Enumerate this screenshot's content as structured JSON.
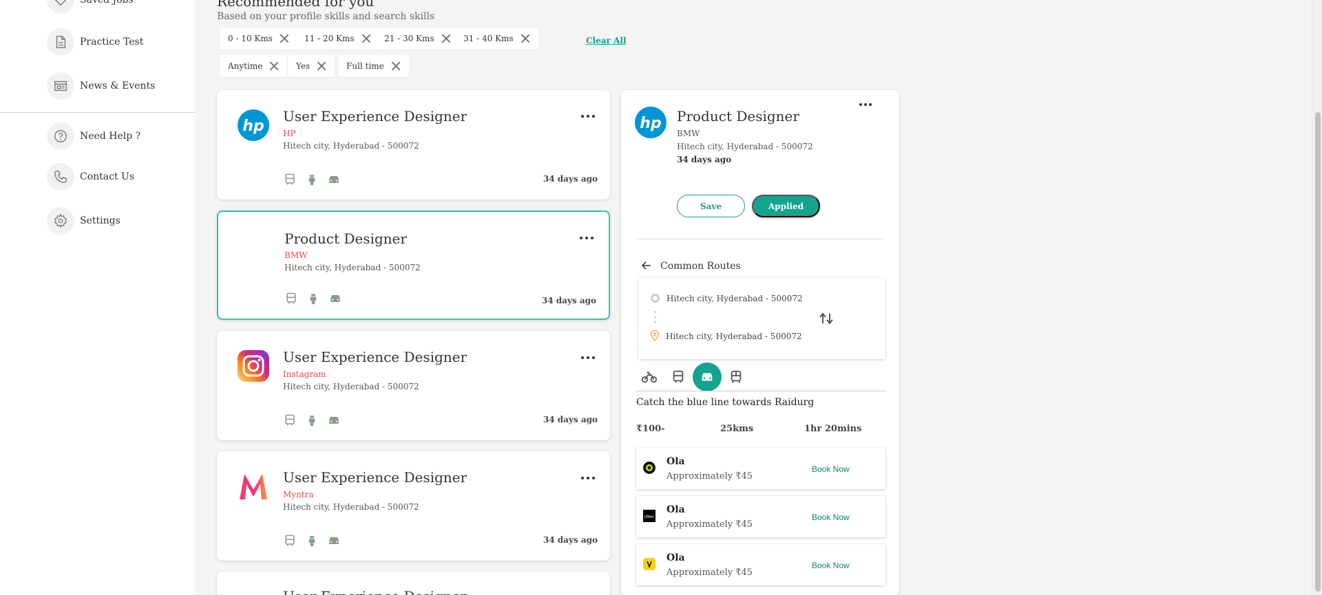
{
  "sidebar": {
    "items": [
      {
        "label": "Saved Jobs",
        "icon": "heart-icon"
      },
      {
        "label": "Practice Test",
        "icon": "document-icon"
      },
      {
        "label": "News & Events",
        "icon": "news-icon"
      },
      {
        "label": "Need Help ?",
        "icon": "help-icon"
      },
      {
        "label": "Contact Us",
        "icon": "phone-icon"
      },
      {
        "label": "Settings",
        "icon": "gear-icon"
      }
    ]
  },
  "main": {
    "title": "Recommended for you",
    "subtitle": "Based on your profile skills and search skills",
    "filters": [
      "0 - 10 Kms",
      "11 - 20 Kms",
      "21 - 30 Kms",
      "31 - 40 Kms",
      "Anytime",
      "Yes",
      "Full time"
    ],
    "clear_all": "Clear All"
  },
  "jobs": [
    {
      "title": "User Experience Designer",
      "company": "HP",
      "location": "Hitech city, Hyderabad - 500072",
      "ago": "34 days ago",
      "logo": "hp-logo"
    },
    {
      "title": "Product Designer",
      "company": "BMW",
      "location": "Hitech city, Hyderabad - 500072",
      "ago": "34 days ago",
      "logo": "none",
      "selected": true
    },
    {
      "title": "User Experience Designer",
      "company": "Instagram",
      "location": "Hitech city, Hyderabad - 500072",
      "ago": "34 days ago",
      "logo": "instagram-logo"
    },
    {
      "title": "User Experience Designer",
      "company": "Myntra",
      "location": "Hitech city, Hyderabad - 500072",
      "ago": "34 days ago",
      "logo": "myntra-logo"
    },
    {
      "title": "User Experience Designer"
    }
  ],
  "detail": {
    "title": "Product Designer",
    "company": "BMW",
    "location": "Hitech city, Hyderabad - 500072",
    "ago": "34 days ago",
    "save_label": "Save",
    "applied_label": "Applied",
    "routes_label": "Common Routes",
    "route_from": "Hitech city, Hyderabad - 500072",
    "route_to": "Hitech city, Hyderabad - 500072",
    "modes": [
      "bike-icon",
      "bus-icon",
      "car-icon",
      "train-icon"
    ],
    "active_mode": "car-icon",
    "hint": "Catch the blue line towards Raidurg",
    "price": "₹100-",
    "distance": "25kms",
    "duration": "1hr 20mins",
    "cabs": [
      {
        "name": "Ola",
        "price": "Approximately ₹45",
        "book": "Book Now",
        "logo": "ola-logo"
      },
      {
        "name": "Ola",
        "price": "Approximately ₹45",
        "book": "Book Now",
        "logo": "uber-logo"
      },
      {
        "name": "Ola",
        "price": "Approximately ₹45",
        "book": "Book Now",
        "logo": "yellow-cab-logo"
      }
    ]
  },
  "colors": {
    "accent": "#14a38f",
    "company": "#e84a4a",
    "selected_border": "#2fc6b5"
  }
}
